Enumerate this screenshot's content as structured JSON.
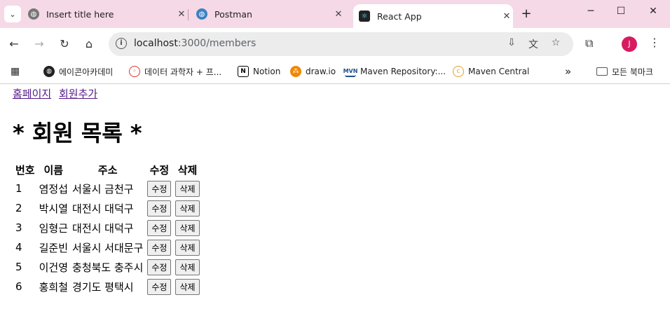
{
  "tabs": [
    {
      "title": "Insert title here",
      "active": false
    },
    {
      "title": "Postman",
      "active": false
    },
    {
      "title": "React App",
      "active": true
    }
  ],
  "window": {
    "minimize": "─",
    "maximize": "☐",
    "close": "✕"
  },
  "omnibox": {
    "host": "localhost",
    "path": ":3000/members"
  },
  "avatar_letter": "J",
  "bookmarks": [
    {
      "label": "에이콘아카데미"
    },
    {
      "label": "데이터 과학자 + 프..."
    },
    {
      "label": "Notion"
    },
    {
      "label": "draw.io"
    },
    {
      "label": "Maven Repository:..."
    },
    {
      "label": "Maven Central"
    }
  ],
  "bookmarks_more": "»",
  "bookmarks_all": "모든 북마크",
  "page": {
    "links": [
      "홈페이지",
      "회원추가"
    ],
    "heading": "* 회원 목록 *",
    "columns": [
      "번호",
      "이름",
      "주소",
      "수정",
      "삭제"
    ],
    "edit_label": "수정",
    "delete_label": "삭제",
    "rows": [
      {
        "num": "1",
        "name": "염정섭",
        "addr": "서울시 금천구"
      },
      {
        "num": "2",
        "name": "박시열",
        "addr": "대전시 대덕구"
      },
      {
        "num": "3",
        "name": "임형근",
        "addr": "대전시 대덕구"
      },
      {
        "num": "4",
        "name": "길준빈",
        "addr": "서울시 서대문구"
      },
      {
        "num": "5",
        "name": "이건영",
        "addr": "충청북도 충주시"
      },
      {
        "num": "6",
        "name": "홍희철",
        "addr": "경기도 평택시"
      }
    ]
  }
}
